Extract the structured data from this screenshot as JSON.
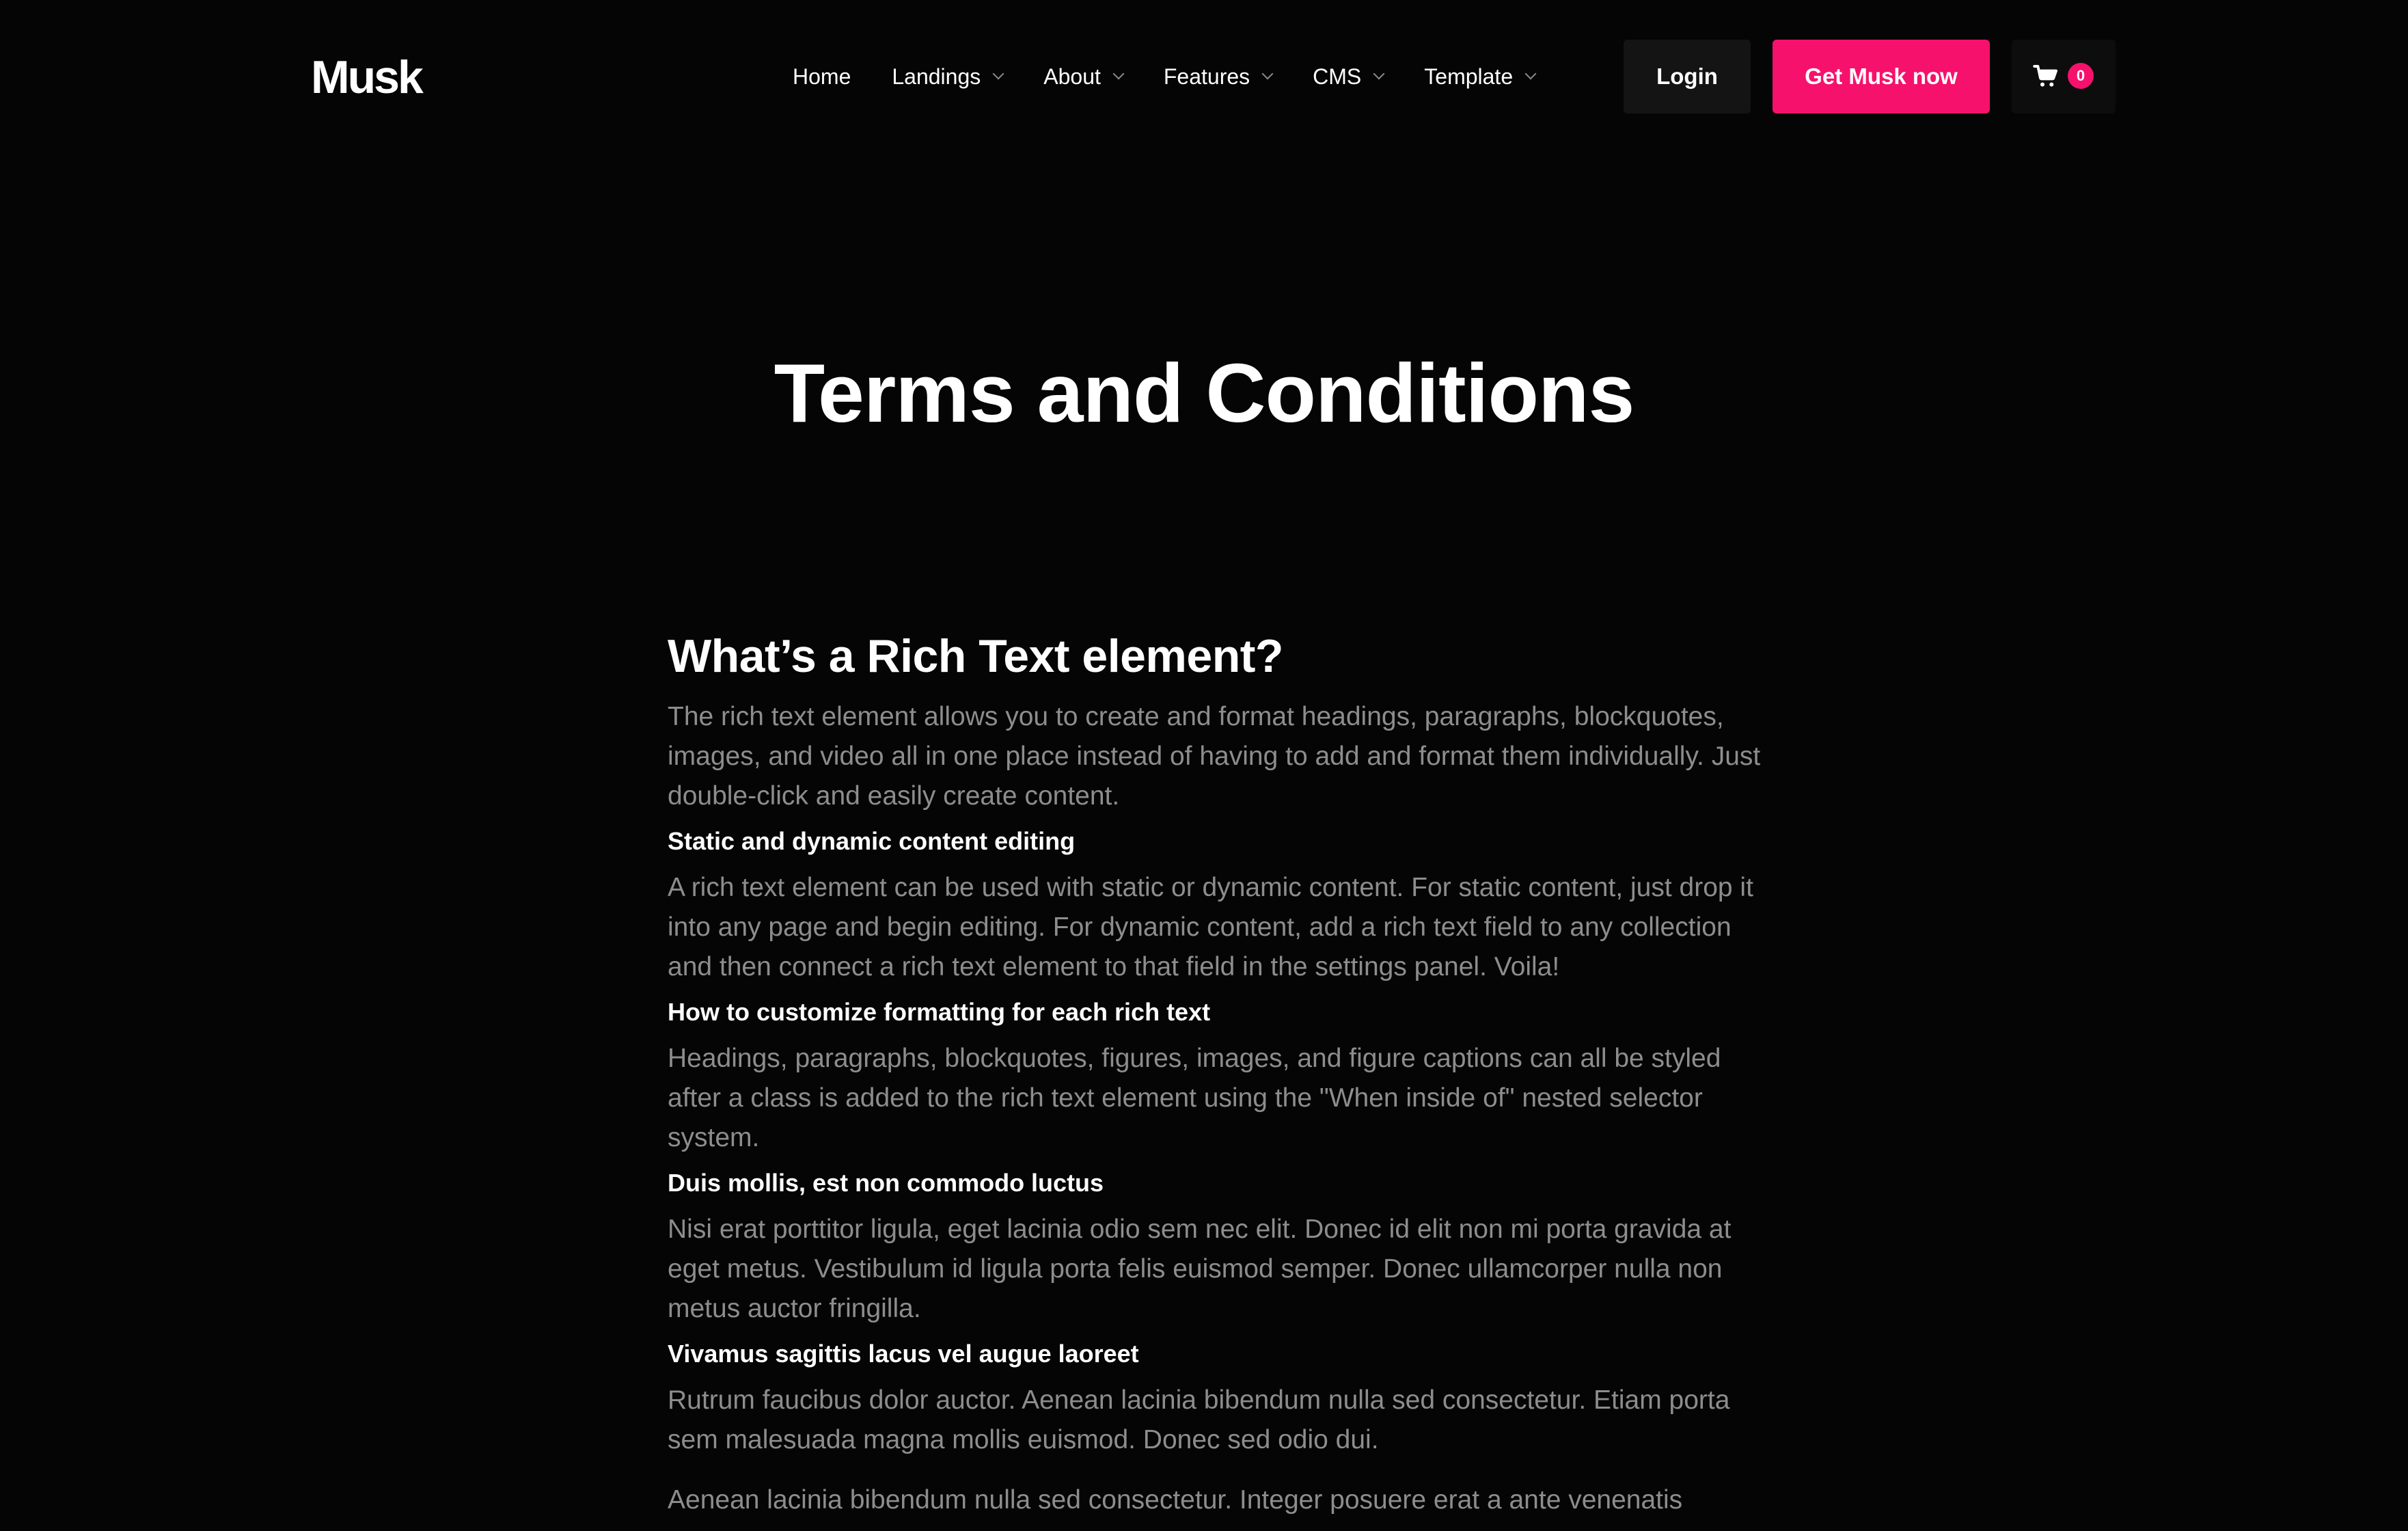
{
  "brand": {
    "logo_text": "Musk",
    "accent_color": "#f6116c",
    "background_color": "#050505"
  },
  "nav": {
    "items": [
      {
        "label": "Home",
        "has_dropdown": false
      },
      {
        "label": "Landings",
        "has_dropdown": true
      },
      {
        "label": "About",
        "has_dropdown": true
      },
      {
        "label": "Features",
        "has_dropdown": true
      },
      {
        "label": "CMS",
        "has_dropdown": true
      },
      {
        "label": "Template",
        "has_dropdown": true
      }
    ],
    "login_label": "Login",
    "cta_label": "Get Musk now",
    "cart_icon": "cart-icon",
    "cart_count": "0"
  },
  "hero": {
    "title": "Terms and Conditions"
  },
  "content": {
    "heading": "What’s a Rich Text element?",
    "intro": "The rich text element allows you to create and format headings, paragraphs, blockquotes, images, and video all in one place instead of having to add and format them individually. Just double-click and easily create content.",
    "sections": [
      {
        "title": "Static and dynamic content editing",
        "body": "A rich text element can be used with static or dynamic content. For static content, just drop it into any page and begin editing. For dynamic content, add a rich text field to any collection and then connect a rich text element to that field in the settings panel. Voila!"
      },
      {
        "title": "How to customize formatting for each rich text",
        "body": "Headings, paragraphs, blockquotes, figures, images, and figure captions can all be styled after a class is added to the rich text element using the \"When inside of\" nested selector system."
      },
      {
        "title": "Duis mollis, est non commodo luctus",
        "body": "Nisi erat porttitor ligula, eget lacinia odio sem nec elit. Donec id elit non mi porta gravida at eget metus. Vestibulum id ligula porta felis euismod semper. Donec ullamcorper nulla non metus auctor fringilla."
      },
      {
        "title": "Vivamus sagittis lacus vel augue laoreet",
        "body": "Rutrum faucibus dolor auctor. Aenean lacinia bibendum nulla sed consectetur. Etiam porta sem malesuada magna mollis euismod. Donec sed odio dui."
      }
    ],
    "trailing": "Aenean lacinia bibendum nulla sed consectetur. Integer posuere erat a ante venenatis"
  }
}
